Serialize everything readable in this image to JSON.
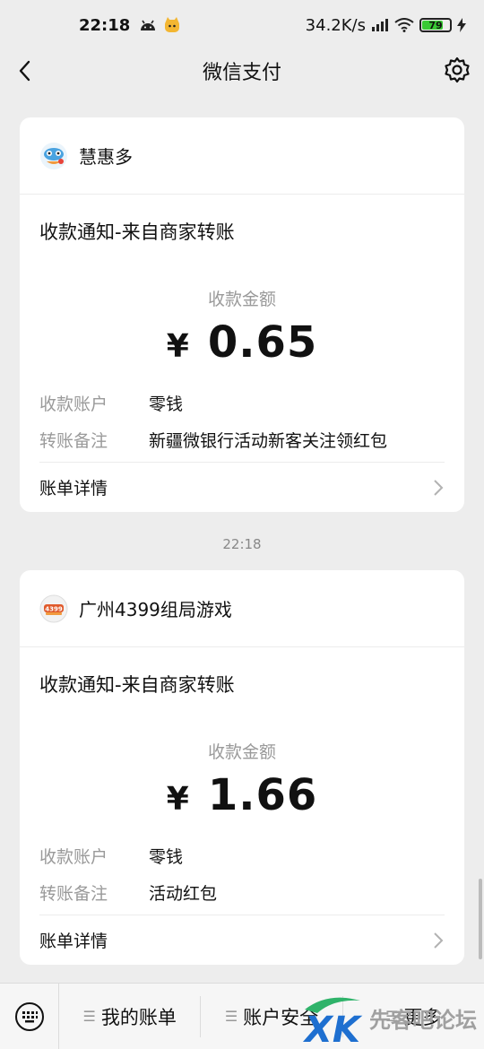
{
  "status_bar": {
    "time": "22:18",
    "network_speed": "34.2K/s",
    "battery_level": "79",
    "icons": [
      "android-icon",
      "notification-cat-icon",
      "signal-icon",
      "wifi-icon",
      "battery-icon",
      "charging-icon"
    ]
  },
  "nav": {
    "title": "微信支付",
    "icons": [
      "back-arrow-icon",
      "gear-icon"
    ]
  },
  "messages": [
    {
      "merchant": "慧惠多",
      "title": "收款通知-来自商家转账",
      "amount_label": "收款金额",
      "currency": "¥",
      "amount": "0.65",
      "fields": [
        {
          "key": "收款账户",
          "value": "零钱"
        },
        {
          "key": "转账备注",
          "value": "新疆微银行活动新客关注领红包"
        }
      ],
      "footer": "账单详情"
    },
    {
      "timestamp": "22:18",
      "merchant": "广州4399组局游戏",
      "title": "收款通知-来自商家转账",
      "amount_label": "收款金额",
      "currency": "¥",
      "amount": "1.66",
      "fields": [
        {
          "key": "收款账户",
          "value": "零钱"
        },
        {
          "key": "转账备注",
          "value": "活动红包"
        }
      ],
      "footer": "账单详情"
    }
  ],
  "bottom_menu": {
    "items": [
      "我的账单",
      "账户安全",
      "更多"
    ],
    "keyboard_icon": "keyboard-icon"
  },
  "watermark": {
    "text": "先客吧论坛",
    "logo_letters": "XK"
  },
  "colors": {
    "background": "#ededed",
    "card": "#ffffff",
    "muted_text": "#9a9a9a",
    "battery_fill": "#38c934",
    "watermark_green": "#2fb36a"
  }
}
